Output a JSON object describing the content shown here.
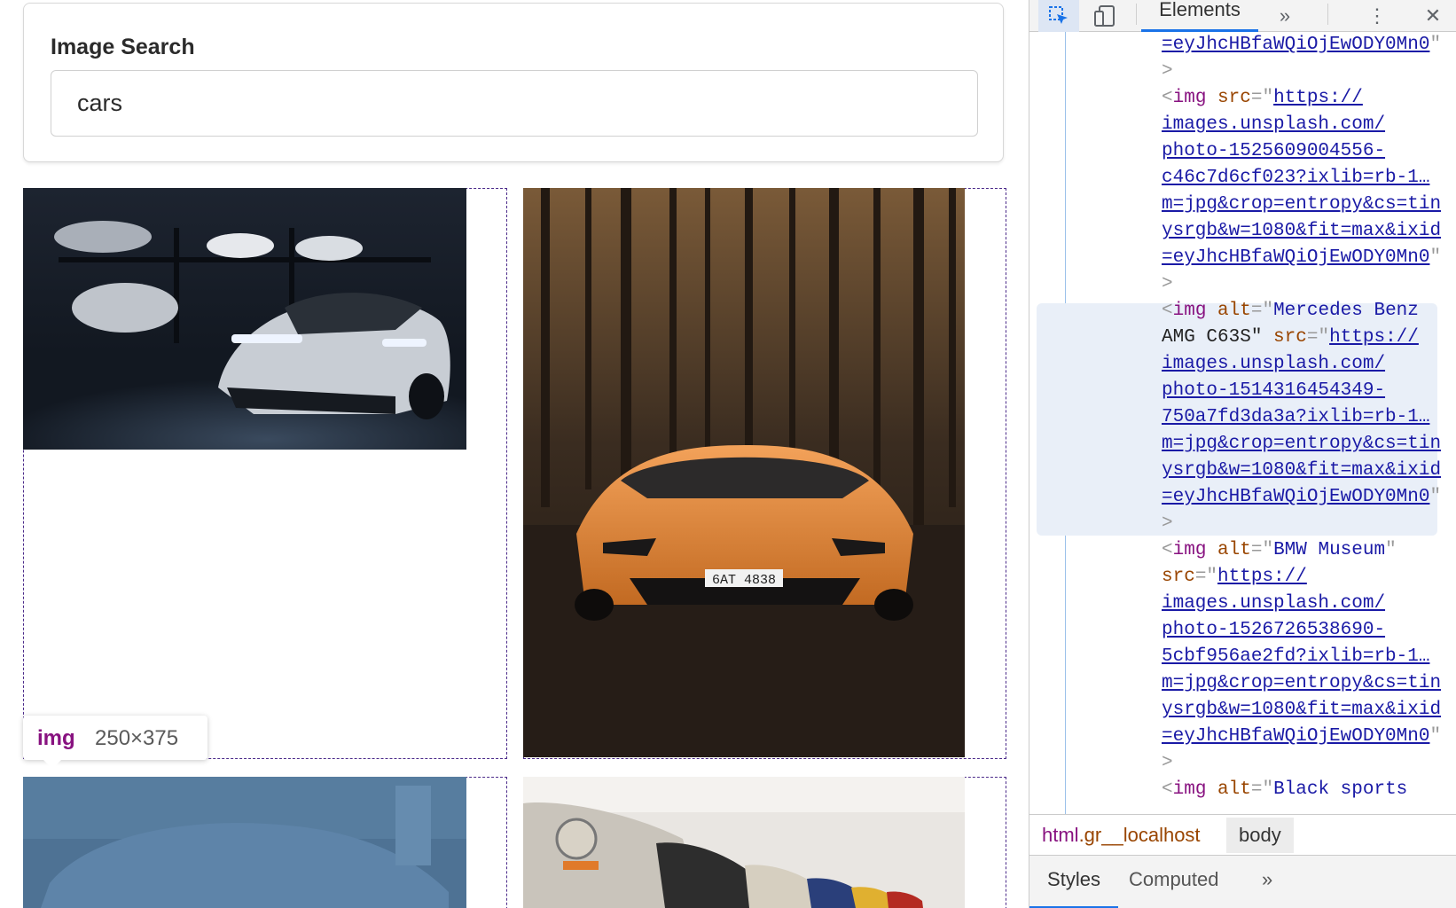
{
  "search": {
    "label": "Image Search",
    "value": "cars"
  },
  "photos": [
    {
      "alt": "white sports car in garage"
    },
    {
      "alt": "orange sports car in forest"
    },
    {
      "alt": "car under blue overlay"
    },
    {
      "alt": "vintage cars in museum row"
    }
  ],
  "tooltip": {
    "tag": "img",
    "dims": "250×375"
  },
  "devtools": {
    "tab_elements": "Elements",
    "more_tabs": "»",
    "menu": "⋮",
    "close": "✕",
    "lines": [
      {
        "kind": "url",
        "text": "=eyJhcHBfaWQiOjEwODY0Mn0\""
      },
      {
        "kind": "gray",
        "text": ">"
      },
      {
        "kind": "img",
        "text": "<img src=\"https://"
      },
      {
        "kind": "url",
        "text": "images.unsplash.com/"
      },
      {
        "kind": "url",
        "text": "photo-1525609004556-"
      },
      {
        "kind": "url",
        "text": "c46c7d6cf023?ixlib=rb-1…"
      },
      {
        "kind": "url",
        "text": "m=jpg&crop=entropy&cs=tin"
      },
      {
        "kind": "url",
        "text": "ysrgb&w=1080&fit=max&ixid"
      },
      {
        "kind": "url",
        "text": "=eyJhcHBfaWQiOjEwODY0Mn0\""
      },
      {
        "kind": "gray",
        "text": ">"
      },
      {
        "kind": "img",
        "text": "<img alt=\"Mercedes Benz"
      },
      {
        "kind": "img",
        "text": "AMG C63S\" src=\"https://"
      },
      {
        "kind": "url",
        "text": "images.unsplash.com/"
      },
      {
        "kind": "url",
        "text": "photo-1514316454349-"
      },
      {
        "kind": "url",
        "text": "750a7fd3da3a?ixlib=rb-1…"
      },
      {
        "kind": "url",
        "text": "m=jpg&crop=entropy&cs=tin"
      },
      {
        "kind": "url",
        "text": "ysrgb&w=1080&fit=max&ixid"
      },
      {
        "kind": "url",
        "text": "=eyJhcHBfaWQiOjEwODY0Mn0\""
      },
      {
        "kind": "gray",
        "text": ">"
      },
      {
        "kind": "img",
        "text": "<img alt=\"BMW Museum\""
      },
      {
        "kind": "img",
        "text": "src=\"https://"
      },
      {
        "kind": "url",
        "text": "images.unsplash.com/"
      },
      {
        "kind": "url",
        "text": "photo-1526726538690-"
      },
      {
        "kind": "url",
        "text": "5cbf956ae2fd?ixlib=rb-1…"
      },
      {
        "kind": "url",
        "text": "m=jpg&crop=entropy&cs=tin"
      },
      {
        "kind": "url",
        "text": "ysrgb&w=1080&fit=max&ixid"
      },
      {
        "kind": "url",
        "text": "=eyJhcHBfaWQiOjEwODY0Mn0\""
      },
      {
        "kind": "gray",
        "text": ">"
      },
      {
        "kind": "img",
        "text": "<img alt=\"Black sports"
      }
    ],
    "breadcrumb": {
      "html_tag": "html",
      "html_class": ".gr__localhost",
      "body": "body"
    },
    "styles_tabs": {
      "styles": "Styles",
      "computed": "Computed",
      "more": "»"
    }
  },
  "colors": {
    "accent": "#1a73e8",
    "outline": "#4b2a8a",
    "tag_purple": "#881280",
    "attr_brown": "#994500",
    "value_blue": "#1a1aa6"
  }
}
